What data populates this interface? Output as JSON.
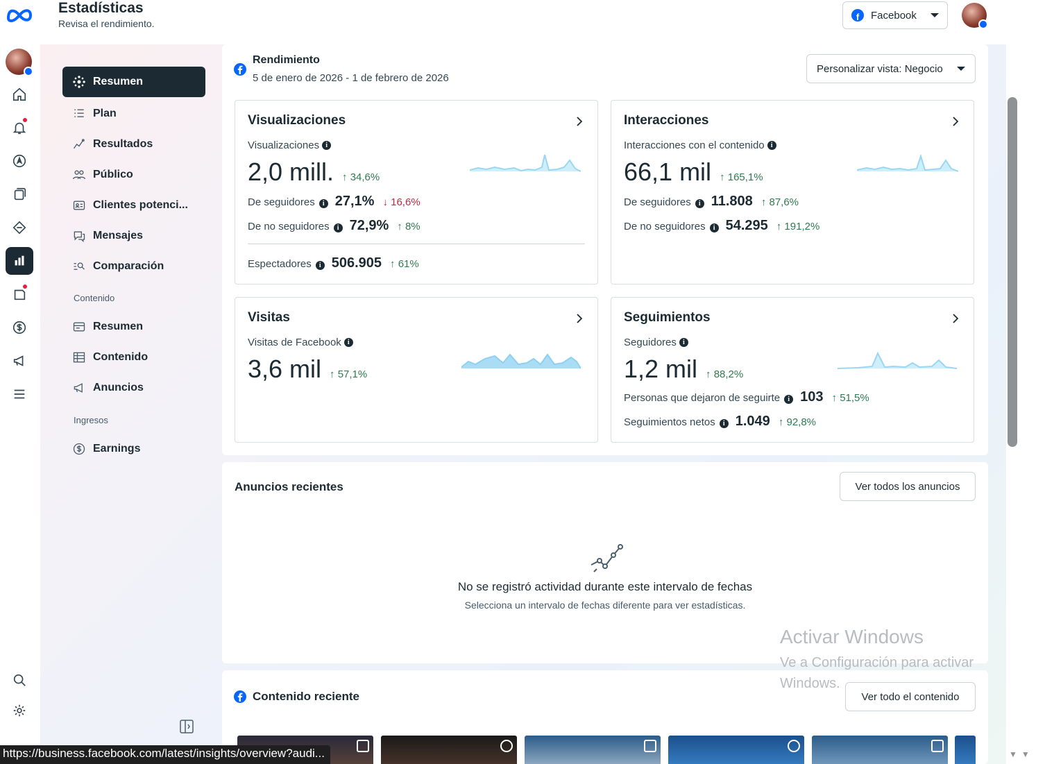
{
  "header": {
    "title": "Estadísticas",
    "subtitle": "Revisa el rendimiento.",
    "platform_selector": "Facebook"
  },
  "sidenav": {
    "items": [
      {
        "label": "Resumen",
        "icon": "overview-icon",
        "active": true
      },
      {
        "label": "Plan",
        "icon": "plan-icon"
      },
      {
        "label": "Resultados",
        "icon": "results-icon"
      },
      {
        "label": "Público",
        "icon": "audience-icon"
      },
      {
        "label": "Clientes potenci...",
        "icon": "leads-icon"
      },
      {
        "label": "Mensajes",
        "icon": "messages-icon"
      },
      {
        "label": "Comparación",
        "icon": "benchmark-icon"
      }
    ],
    "section_content": "Contenido",
    "content_items": [
      {
        "label": "Resumen",
        "icon": "content-overview-icon"
      },
      {
        "label": "Contenido",
        "icon": "content-table-icon"
      },
      {
        "label": "Anuncios",
        "icon": "ads-icon"
      }
    ],
    "section_income": "Ingresos",
    "income_items": [
      {
        "label": "Earnings",
        "icon": "dollar-icon"
      }
    ]
  },
  "performance": {
    "title": "Rendimiento",
    "date_range": "5 de enero de 2026 - 1 de febrero de 2026",
    "customize_label": "Personalizar vista: Negocio"
  },
  "cards": {
    "views": {
      "title": "Visualizaciones",
      "metric_label": "Visualizaciones",
      "value": "2,0 mill.",
      "delta": "↑ 34,6%",
      "rows": [
        {
          "label": "De seguidores",
          "value": "27,1%",
          "delta": "↓ 16,6%",
          "trend": "down"
        },
        {
          "label": "De no seguidores",
          "value": "72,9%",
          "delta": "↑ 8%",
          "trend": "up"
        }
      ],
      "extra": {
        "label": "Espectadores",
        "value": "506.905",
        "delta": "↑ 61%"
      }
    },
    "interactions": {
      "title": "Interacciones",
      "metric_label": "Interacciones con el contenido",
      "value": "66,1 mil",
      "delta": "↑ 165,1%",
      "rows": [
        {
          "label": "De seguidores",
          "value": "11.808",
          "delta": "↑ 87,6%",
          "trend": "up"
        },
        {
          "label": "De no seguidores",
          "value": "54.295",
          "delta": "↑ 191,2%",
          "trend": "up"
        }
      ]
    },
    "visits": {
      "title": "Visitas",
      "metric_label": "Visitas de Facebook",
      "value": "3,6 mil",
      "delta": "↑ 57,1%"
    },
    "follows": {
      "title": "Seguimientos",
      "metric_label": "Seguidores",
      "value": "1,2 mil",
      "delta": "↑ 88,2%",
      "rows": [
        {
          "label": "Personas que dejaron de seguirte",
          "value": "103",
          "delta": "↑ 51,5%",
          "trend": "up"
        },
        {
          "label": "Seguimientos netos",
          "value": "1.049",
          "delta": "↑ 92,8%",
          "trend": "up"
        }
      ]
    }
  },
  "ads": {
    "title": "Anuncios recientes",
    "button": "Ver todos los anuncios",
    "empty_title": "No se registró actividad durante este intervalo de fechas",
    "empty_subtitle": "Selecciona un intervalo de fechas diferente para ver estadísticas."
  },
  "recent_content": {
    "title": "Contenido reciente",
    "button": "Ver todo el contenido"
  },
  "watermark": {
    "line1": "Activar Windows",
    "line2": "Ve a Configuración para activar Windows."
  },
  "status_url": "https://business.facebook.com/latest/insights/overview?audi...",
  "colors": {
    "accent_dark": "#1c2b33",
    "facebook_blue": "#0866ff",
    "positive": "#2f7a51",
    "negative": "#c5263e",
    "sparkline": "#a9dcf5"
  }
}
